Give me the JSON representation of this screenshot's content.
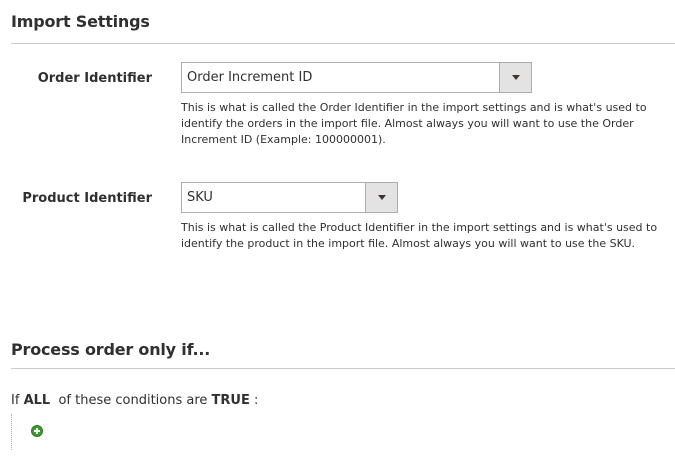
{
  "import_settings": {
    "title": "Import Settings",
    "order_identifier": {
      "label": "Order Identifier",
      "value": "Order Increment ID",
      "note": "This is what is called the Order Identifier in the import settings and is what's used to identify the orders in the import file. Almost always you will want to use the Order Increment ID (Example: 100000001)."
    },
    "product_identifier": {
      "label": "Product Identifier",
      "value": "SKU",
      "note": "This is what is called the Product Identifier in the import settings and is what's used to identify the product in the import file. Almost always you will want to use the SKU."
    }
  },
  "process_conditions": {
    "title": "Process order only if...",
    "prefix": "If",
    "aggregator": "ALL",
    "middle": "of these conditions are",
    "value": "TRUE",
    "suffix": ":",
    "add_icon": "add-circle-icon"
  }
}
